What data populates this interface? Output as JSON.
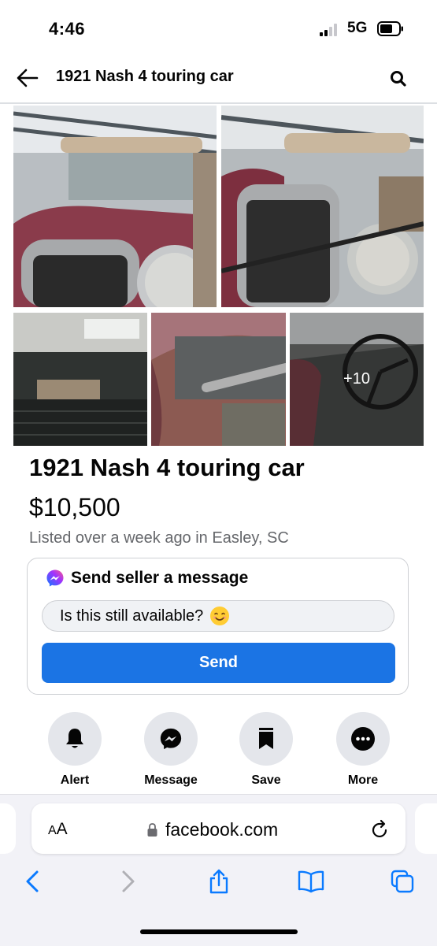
{
  "status_bar": {
    "time": "4:46",
    "network": "5G"
  },
  "header": {
    "title": "1921 Nash 4 touring car"
  },
  "photos": {
    "more_count": "+10"
  },
  "listing": {
    "title": "1921 Nash 4 touring car",
    "price": "$10,500",
    "listed": "Listed over a week ago in Easley, SC"
  },
  "message_card": {
    "heading": "Send seller a message",
    "input_value": "Is this still available?",
    "send_label": "Send"
  },
  "actions": [
    {
      "label": "Alert",
      "icon": "bell-icon"
    },
    {
      "label": "Message",
      "icon": "messenger-icon"
    },
    {
      "label": "Save",
      "icon": "bookmark-icon"
    },
    {
      "label": "More",
      "icon": "more-icon"
    }
  ],
  "browser": {
    "text_size_label": "AA",
    "domain": "facebook.com"
  },
  "colors": {
    "accent": "#1b74e4",
    "secondary_text": "#65676b",
    "ios_blue": "#0a7aff"
  }
}
